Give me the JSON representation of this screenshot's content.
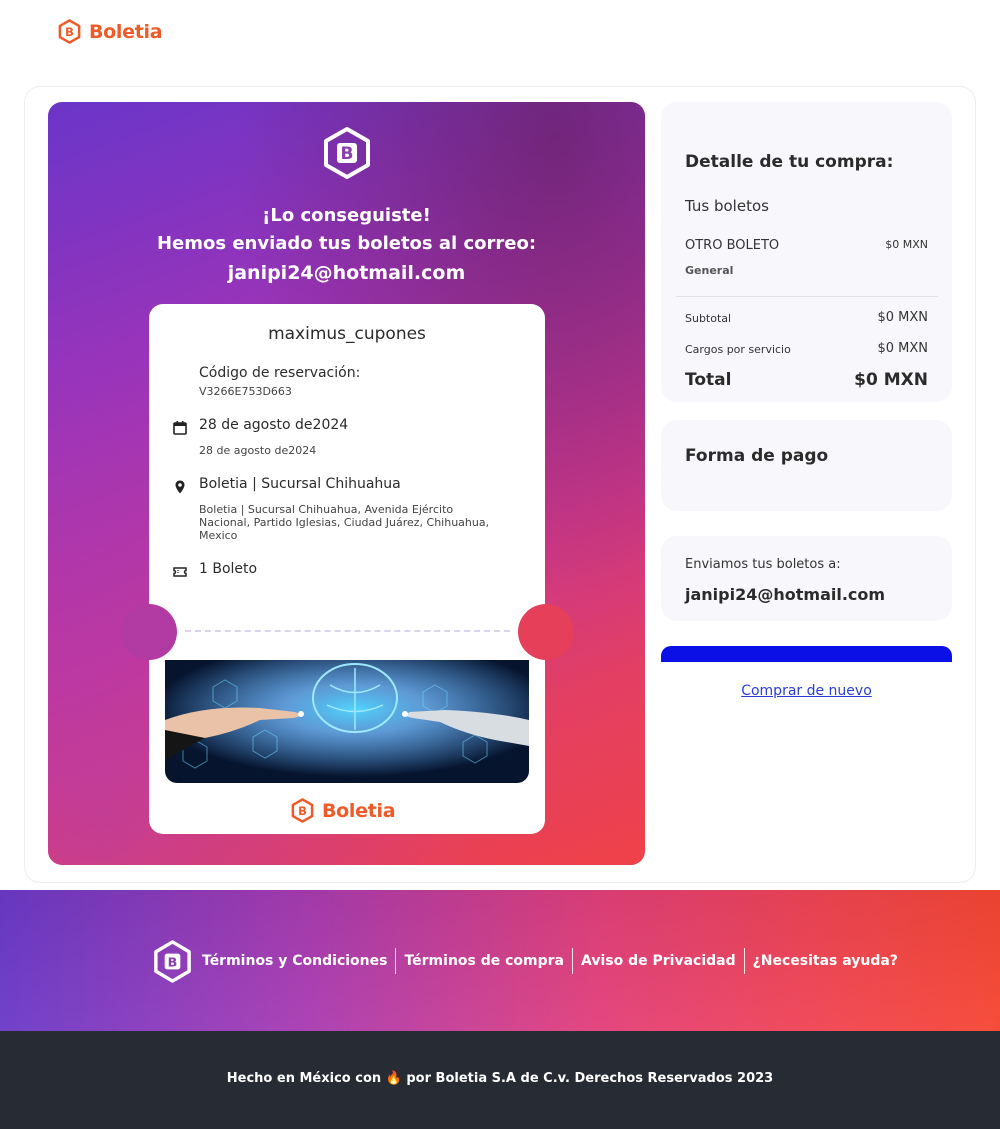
{
  "brand": {
    "name": "Boletia",
    "accent": "#f05a28"
  },
  "hero": {
    "line1": "¡Lo conseguiste!",
    "line2": "Hemos enviado tus boletos al correo:",
    "email": "janipi24@hotmail.com"
  },
  "ticket": {
    "title": "maximus_cupones",
    "reservation_label": "Código de reservación:",
    "reservation_code": "V3266E753D663",
    "date_main": "28 de agosto de2024",
    "date_sub": "28 de agosto de2024",
    "venue": "Boletia | Sucursal Chihuahua",
    "address": "Boletia | Sucursal Chihuahua, Avenida Ejército Nacional, Partido Iglesias, Ciudad Juárez, Chihuahua, Mexico",
    "quantity": "1 Boleto",
    "brand": "Boletia"
  },
  "summary": {
    "heading": "Detalle de tu compra:",
    "tickets_heading": "Tus boletos",
    "item_name": "OTRO BOLETO",
    "item_price": "$0 MXN",
    "item_type": "General",
    "subtotal_label": "Subtotal",
    "subtotal_value": "$0 MXN",
    "fees_label": "Cargos por servicio",
    "fees_value": "$0 MXN",
    "total_label": "Total",
    "total_value": "$0 MXN"
  },
  "payment": {
    "heading": "Forma de pago"
  },
  "delivery": {
    "label": "Enviamos tus boletos a:",
    "email": "janipi24@hotmail.com"
  },
  "actions": {
    "rebuy": "Comprar de nuevo",
    "cta_color": "#0a10e6"
  },
  "footer": {
    "links": [
      "Términos y Condiciones",
      "Términos de compra",
      "Aviso de Privacidad",
      "¿Necesitas ayuda?"
    ],
    "copyright": "Hecho en México con 🔥 por Boletia S.A de C.v. Derechos Reservados 2023"
  }
}
